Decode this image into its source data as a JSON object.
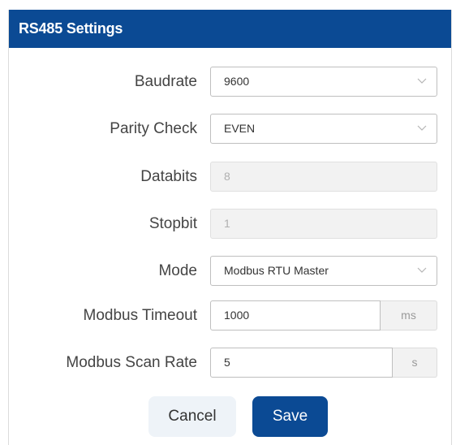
{
  "dialog": {
    "title": "RS485 Settings"
  },
  "form": {
    "baudrate": {
      "label": "Baudrate",
      "value": "9600"
    },
    "parity": {
      "label": "Parity Check",
      "value": "EVEN"
    },
    "databits": {
      "label": "Databits",
      "value": "8"
    },
    "stopbit": {
      "label": "Stopbit",
      "value": "1"
    },
    "mode": {
      "label": "Mode",
      "value": "Modbus RTU Master"
    },
    "timeout": {
      "label": "Modbus Timeout",
      "value": "1000",
      "unit": "ms"
    },
    "scan_rate": {
      "label": "Modbus Scan Rate",
      "value": "5",
      "unit": "s"
    }
  },
  "buttons": {
    "cancel": "Cancel",
    "save": "Save"
  },
  "icons": {
    "select_arrow": "chevron-down-icon"
  },
  "colors": {
    "primary": "#0b4a94",
    "cancel_bg": "#eef3f8",
    "disabled_bg": "#f2f2f2"
  }
}
